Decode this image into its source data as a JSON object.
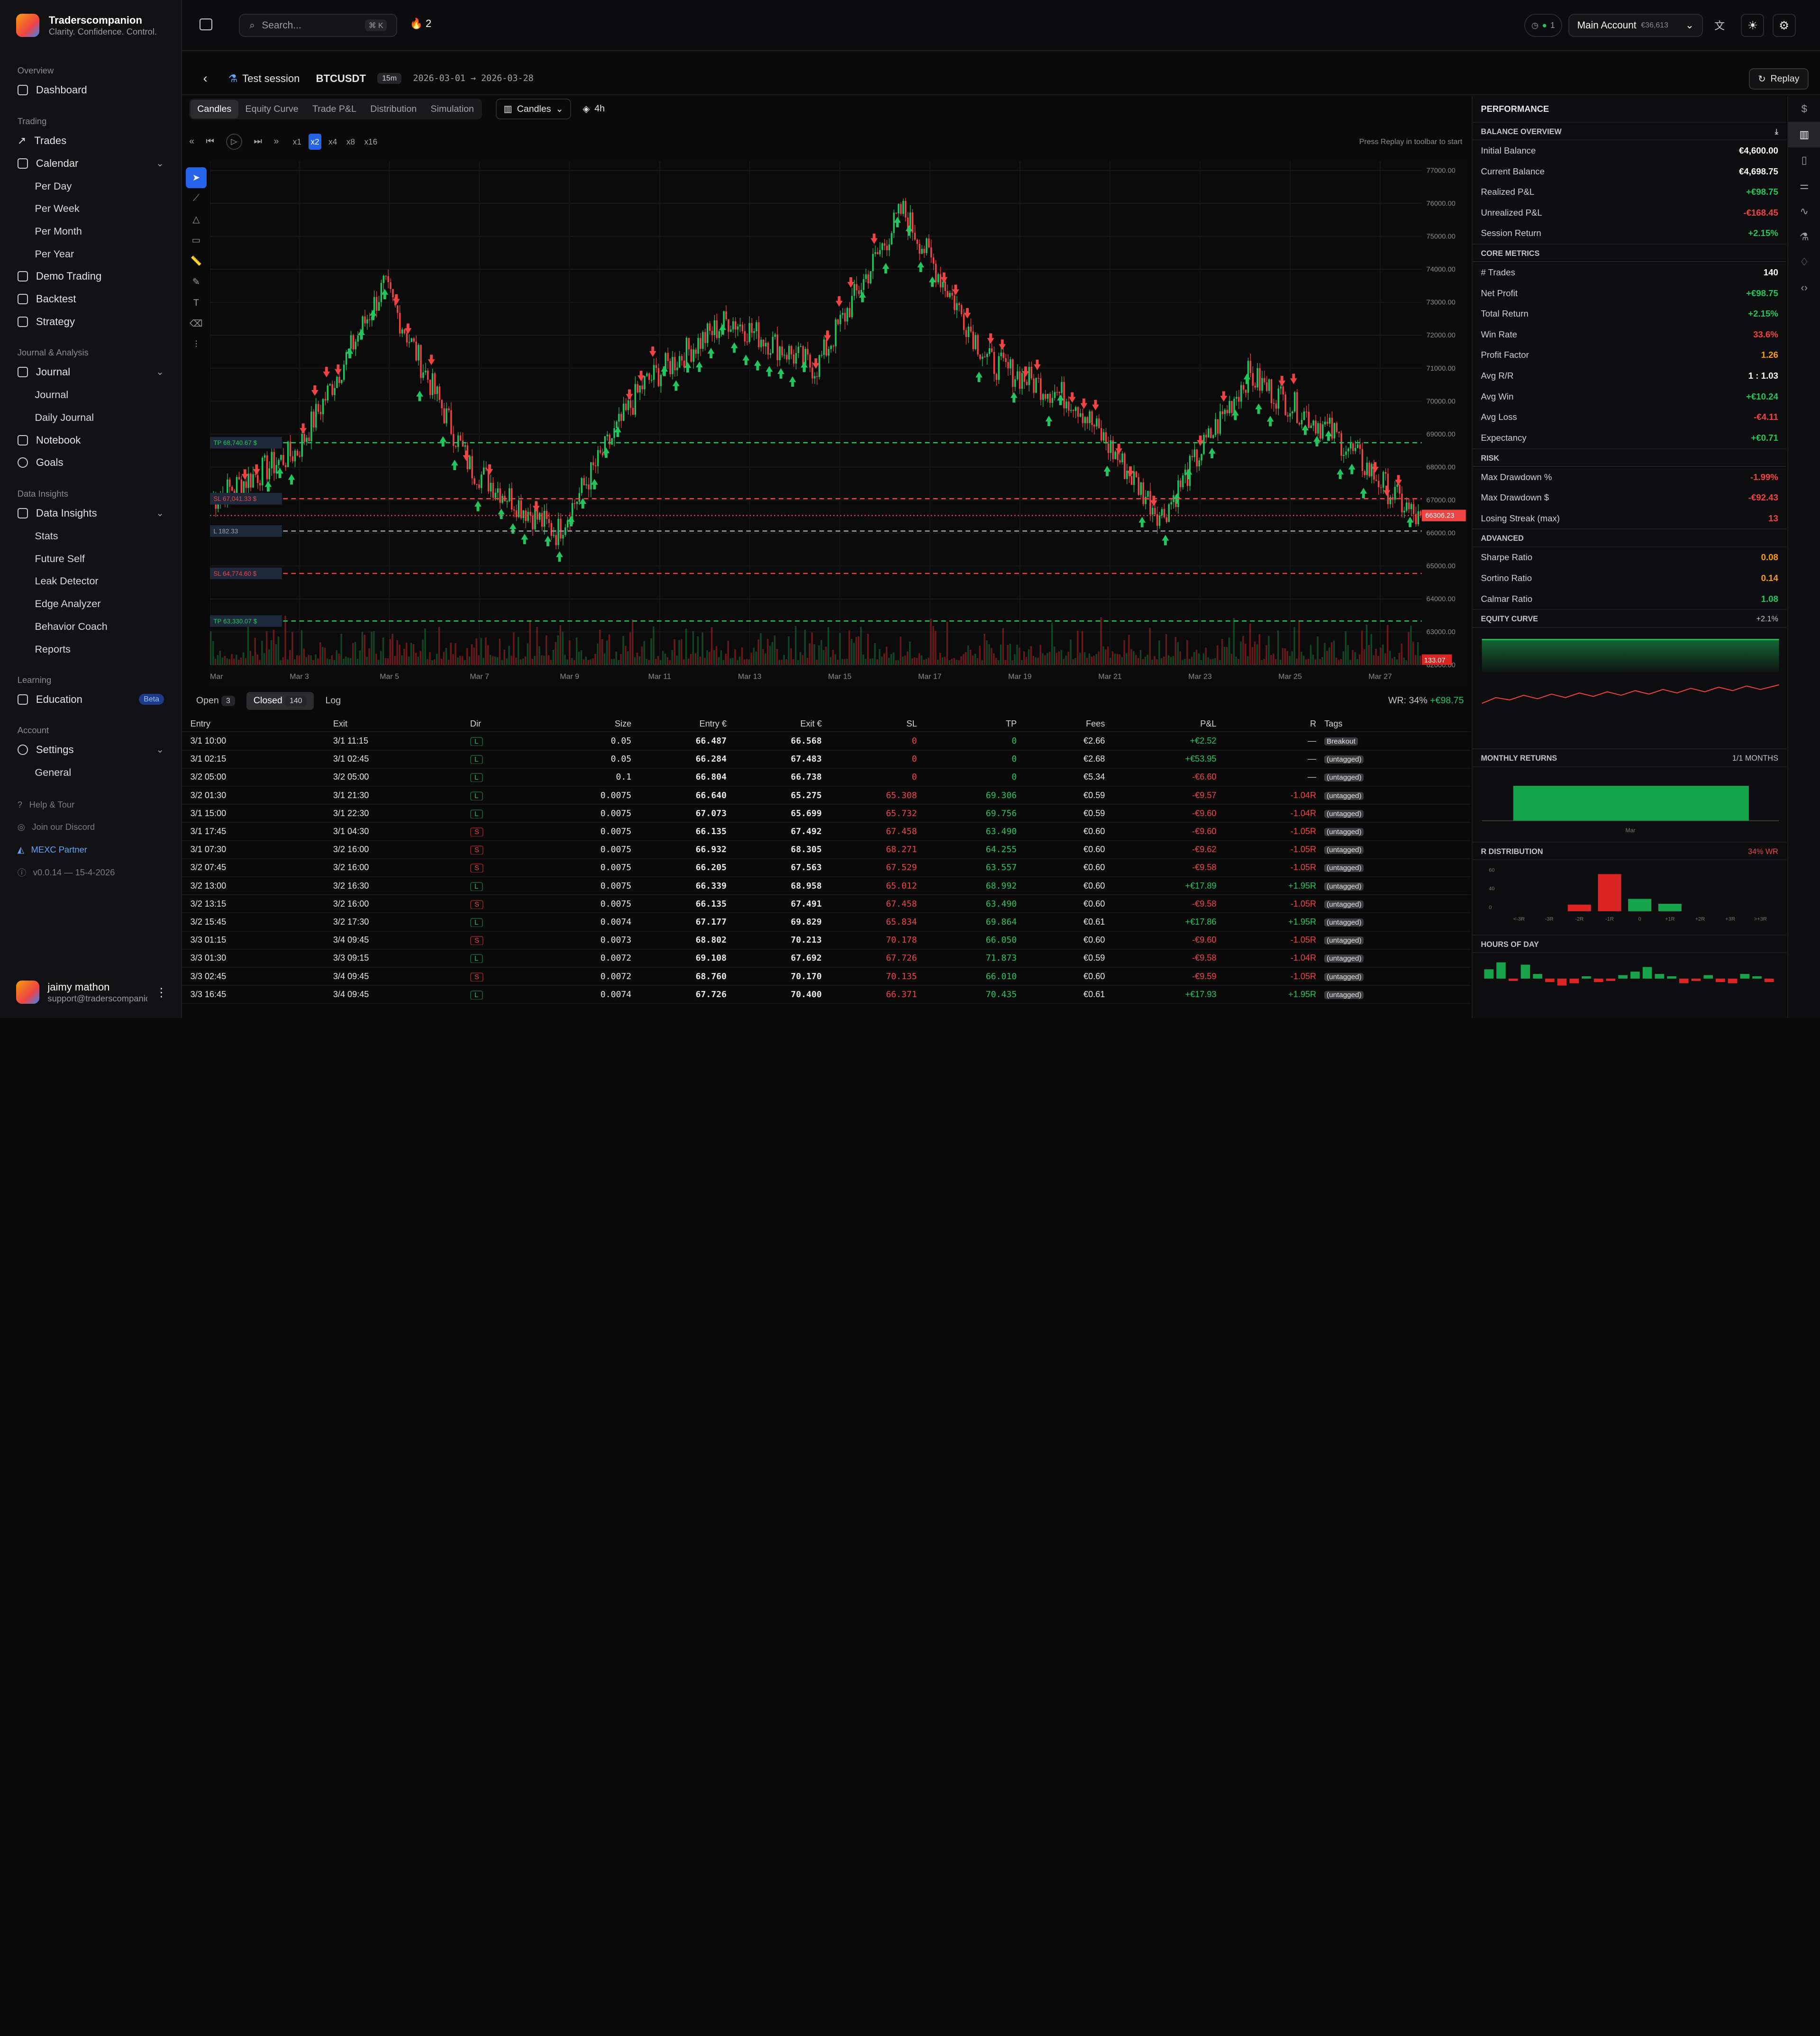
{
  "brand": {
    "title": "Traderscompanion",
    "subtitle": "Clarity. Confidence. Control."
  },
  "sidebar": {
    "overview_label": "Overview",
    "dashboard": "Dashboard",
    "trading_label": "Trading",
    "trades": "Trades",
    "calendar": "Calendar",
    "calendar_items": [
      "Per Day",
      "Per Week",
      "Per Month",
      "Per Year"
    ],
    "demo": "Demo Trading",
    "backtest": "Backtest",
    "strategy": "Strategy",
    "journal_label": "Journal & Analysis",
    "journal": "Journal",
    "journal_items": [
      "Journal",
      "Daily Journal"
    ],
    "notebook": "Notebook",
    "goals": "Goals",
    "insights_label": "Data Insights",
    "insights": "Data Insights",
    "insights_items": [
      "Stats",
      "Future Self",
      "Leak Detector",
      "Edge Analyzer",
      "Behavior Coach",
      "Reports"
    ],
    "learning_label": "Learning",
    "education": "Education",
    "beta": "Beta",
    "account_label": "Account",
    "settings": "Settings",
    "settings_items": [
      "General"
    ],
    "help": "Help & Tour",
    "discord": "Join our Discord",
    "partner": "MEXC Partner",
    "version": "v0.0.14 — 15-4-2026",
    "user_name": "jaimy mathon",
    "user_email": "support@traderscompanion.com"
  },
  "topbar": {
    "search_placeholder": "Search...",
    "kbd": "⌘ K",
    "streak": "2",
    "status": "1",
    "account": "Main Account",
    "account_sub": "€36,613"
  },
  "session": {
    "name": "Test session",
    "symbol": "BTCUSDT",
    "tf": "15m",
    "range": "2026-03-01 → 2026-03-28",
    "replay": "Replay"
  },
  "tabs": [
    "Candles",
    "Equity Curve",
    "Trade P&L",
    "Distribution",
    "Simulation"
  ],
  "chart_type": "Candles",
  "interval": "4h",
  "speeds": [
    "x1",
    "x2",
    "x4",
    "x8",
    "x16"
  ],
  "hint": "Press Replay in toolbar to start",
  "chart_data": {
    "type": "line",
    "x": [
      "Mar 1",
      "Mar 3",
      "Mar 5",
      "Mar 7",
      "Mar 9",
      "Mar 11",
      "Mar 13",
      "Mar 15",
      "Mar 17",
      "Mar 19",
      "Mar 21",
      "Mar 23",
      "Mar 25",
      "Mar 27",
      "Mar 28"
    ],
    "y": [
      67000,
      68500,
      73500,
      68000,
      66000,
      70500,
      72500,
      71000,
      75800,
      71200,
      70000,
      66500,
      70800,
      69000,
      66306
    ],
    "ylim": [
      62000,
      77000
    ],
    "yticks": [
      "77000.00",
      "76000.00",
      "75000.00",
      "74000.00",
      "73000.00",
      "72000.00",
      "71000.00",
      "70000.00",
      "69000.00",
      "68000.00",
      "67000.00",
      "66000.00",
      "65000.00",
      "64000.00",
      "63000.00",
      "62000.00"
    ],
    "xticks": [
      "Mar",
      "Mar 3",
      "Mar 5",
      "Mar 7",
      "Mar 9",
      "Mar 11",
      "Mar 13",
      "Mar 15",
      "Mar 17",
      "Mar 19",
      "Mar 21",
      "Mar 23",
      "Mar 25",
      "Mar 27"
    ],
    "price_label": "66306.23",
    "volume_label": "133.07",
    "levels": [
      {
        "label": "TP 68,740.67 $",
        "value": 68740,
        "color": "#22c55e",
        "dash": true
      },
      {
        "label": "SL 67,041.33 $",
        "value": 67041,
        "color": "#ef4444",
        "dash": true
      },
      {
        "label": "L 182.33",
        "value": 66060,
        "color": "#9ca3af",
        "dash": true
      },
      {
        "label": "SL 64,774.60 $",
        "value": 64774,
        "color": "#ef4444",
        "dash": true
      },
      {
        "label": "TP 63,330.07 $",
        "value": 63330,
        "color": "#22c55e",
        "dash": true
      }
    ]
  },
  "bottom_tabs": [
    "Open",
    "3",
    "Closed",
    "140",
    "Log"
  ],
  "wr": "WR: 34%",
  "wr_pnl": "+€98.75",
  "table": {
    "headers": [
      "Entry",
      "Exit",
      "Dir",
      "Size",
      "Entry €",
      "Exit €",
      "SL",
      "TP",
      "Fees",
      "P&L",
      "R",
      "Tags"
    ],
    "rows": [
      [
        "3/1 10:00",
        "3/1 11:15",
        "L",
        "0.05",
        "66.487",
        "66.568",
        "0",
        "0",
        "€2.66",
        "+€2.52",
        "—",
        "Breakout"
      ],
      [
        "3/1 02:15",
        "3/1 02:45",
        "L",
        "0.05",
        "66.284",
        "67.483",
        "0",
        "0",
        "€2.68",
        "+€53.95",
        "—",
        "(untagged)"
      ],
      [
        "3/2 05:00",
        "3/2 05:00",
        "L",
        "0.1",
        "66.804",
        "66.738",
        "0",
        "0",
        "€5.34",
        "-€6.60",
        "—",
        "(untagged)"
      ],
      [
        "3/2 01:30",
        "3/1 21:30",
        "L",
        "0.0075",
        "66.640",
        "65.275",
        "65.308",
        "69.306",
        "€0.59",
        "-€9.57",
        "-1.04R",
        "(untagged)"
      ],
      [
        "3/1 15:00",
        "3/1 22:30",
        "L",
        "0.0075",
        "67.073",
        "65.699",
        "65.732",
        "69.756",
        "€0.59",
        "-€9.60",
        "-1.04R",
        "(untagged)"
      ],
      [
        "3/1 17:45",
        "3/1 04:30",
        "S",
        "0.0075",
        "66.135",
        "67.492",
        "67.458",
        "63.490",
        "€0.60",
        "-€9.60",
        "-1.05R",
        "(untagged)"
      ],
      [
        "3/1 07:30",
        "3/2 16:00",
        "S",
        "0.0075",
        "66.932",
        "68.305",
        "68.271",
        "64.255",
        "€0.60",
        "-€9.62",
        "-1.05R",
        "(untagged)"
      ],
      [
        "3/2 07:45",
        "3/2 16:00",
        "S",
        "0.0075",
        "66.205",
        "67.563",
        "67.529",
        "63.557",
        "€0.60",
        "-€9.58",
        "-1.05R",
        "(untagged)"
      ],
      [
        "3/2 13:00",
        "3/2 16:30",
        "L",
        "0.0075",
        "66.339",
        "68.958",
        "65.012",
        "68.992",
        "€0.60",
        "+€17.89",
        "+1.95R",
        "(untagged)"
      ],
      [
        "3/2 13:15",
        "3/2 16:00",
        "S",
        "0.0075",
        "66.135",
        "67.491",
        "67.458",
        "63.490",
        "€0.60",
        "-€9.58",
        "-1.05R",
        "(untagged)"
      ],
      [
        "3/2 15:45",
        "3/2 17:30",
        "L",
        "0.0074",
        "67.177",
        "69.829",
        "65.834",
        "69.864",
        "€0.61",
        "+€17.86",
        "+1.95R",
        "(untagged)"
      ],
      [
        "3/3 01:15",
        "3/4 09:45",
        "S",
        "0.0073",
        "68.802",
        "70.213",
        "70.178",
        "66.050",
        "€0.60",
        "-€9.60",
        "-1.05R",
        "(untagged)"
      ],
      [
        "3/3 01:30",
        "3/3 09:15",
        "L",
        "0.0072",
        "69.108",
        "67.692",
        "67.726",
        "71.873",
        "€0.59",
        "-€9.58",
        "-1.04R",
        "(untagged)"
      ],
      [
        "3/3 02:45",
        "3/4 09:45",
        "S",
        "0.0072",
        "68.760",
        "70.170",
        "70.135",
        "66.010",
        "€0.60",
        "-€9.59",
        "-1.05R",
        "(untagged)"
      ],
      [
        "3/3 16:45",
        "3/4 09:45",
        "L",
        "0.0074",
        "67.726",
        "70.400",
        "66.371",
        "70.435",
        "€0.61",
        "+€17.93",
        "+1.95R",
        "(untagged)"
      ]
    ]
  },
  "perf": {
    "title": "PERFORMANCE",
    "balance_title": "BALANCE OVERVIEW",
    "balance": [
      [
        "Initial Balance",
        "€4,600.00",
        "white"
      ],
      [
        "Current Balance",
        "€4,698.75",
        "white"
      ],
      [
        "Realized P&L",
        "+€98.75",
        "green"
      ],
      [
        "Unrealized P&L",
        "-€168.45",
        "red"
      ],
      [
        "Session Return",
        "+2.15%",
        "green"
      ]
    ],
    "core_title": "CORE METRICS",
    "core": [
      [
        "# Trades",
        "140",
        "white"
      ],
      [
        "Net Profit",
        "+€98.75",
        "green"
      ],
      [
        "Total Return",
        "+2.15%",
        "green"
      ],
      [
        "Win Rate",
        "33.6%",
        "red"
      ],
      [
        "Profit Factor",
        "1.26",
        "orange"
      ],
      [
        "Avg R/R",
        "1 : 1.03",
        "white"
      ],
      [
        "Avg Win",
        "+€10.24",
        "green"
      ],
      [
        "Avg Loss",
        "-€4.11",
        "red"
      ],
      [
        "Expectancy",
        "+€0.71",
        "green"
      ]
    ],
    "risk_title": "RISK",
    "risk": [
      [
        "Max Drawdown %",
        "-1.99%",
        "red"
      ],
      [
        "Max Drawdown $",
        "-€92.43",
        "red"
      ],
      [
        "Losing Streak (max)",
        "13",
        "red"
      ]
    ],
    "adv_title": "ADVANCED",
    "adv": [
      [
        "Sharpe Ratio",
        "0.08",
        "orange"
      ],
      [
        "Sortino Ratio",
        "0.14",
        "orange"
      ],
      [
        "Calmar Ratio",
        "1.08",
        "green"
      ]
    ],
    "equity_title": "EQUITY CURVE",
    "equity_val": "+2.1%",
    "monthly_title": "MONTHLY RETURNS",
    "monthly_val": "1/1 MONTHS",
    "monthly_x": "Mar",
    "rdist_title": "R DISTRIBUTION",
    "rdist_val": "34% WR",
    "rdist_y": [
      "60",
      "40",
      "0"
    ],
    "rdist_x": [
      "<-3R",
      "-3R",
      "-2R",
      "-1R",
      "0",
      "+1R",
      "+2R",
      "+3R",
      ">+3R"
    ],
    "rdist_values": [
      0,
      0,
      8,
      45,
      15,
      9,
      0,
      0,
      0
    ],
    "hours_title": "HOURS OF DAY"
  }
}
